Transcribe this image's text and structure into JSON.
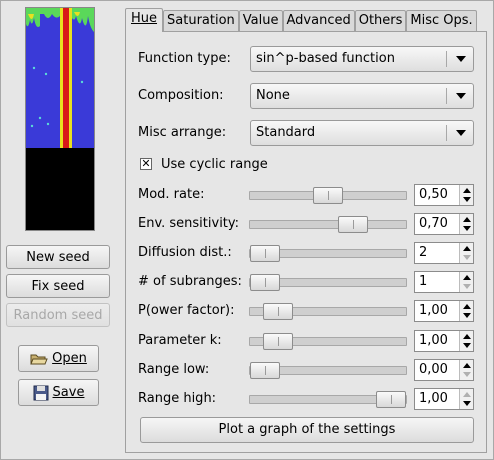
{
  "left": {
    "new_seed": "New seed",
    "fix_seed": "Fix seed",
    "random_seed": "Random seed",
    "open": "Open",
    "save": "Save"
  },
  "tabs": [
    {
      "label": "Hue",
      "active": true
    },
    {
      "label": "Saturation"
    },
    {
      "label": "Value"
    },
    {
      "label": "Advanced"
    },
    {
      "label": "Others"
    },
    {
      "label": "Misc Ops."
    }
  ],
  "hue": {
    "function_type_label": "Function type:",
    "function_type_value": "sin^p-based function",
    "composition_label": "Composition:",
    "composition_value": "None",
    "misc_arrange_label": "Misc arrange:",
    "misc_arrange_value": "Standard",
    "cyclic_label": "Use cyclic range",
    "cyclic_checked": true,
    "sliders": [
      {
        "label": "Mod. rate:",
        "value": "0,50",
        "fraction": 0.5
      },
      {
        "label": "Env. sensitivity:",
        "value": "0,70",
        "fraction": 0.7
      },
      {
        "label": "Diffusion dist.:",
        "value": "2",
        "fraction": 0.0
      },
      {
        "label": "# of subranges:",
        "value": "1",
        "fraction": 0.0
      },
      {
        "label": "P(ower factor):",
        "value": "1,00",
        "fraction": 0.1
      },
      {
        "label": "Parameter k:",
        "value": "1,00",
        "fraction": 0.1
      },
      {
        "label": "Range low:",
        "value": "0,00",
        "fraction": 0.0
      },
      {
        "label": "Range high:",
        "value": "1,00",
        "fraction": 1.0
      }
    ],
    "plot_button": "Plot a graph of the settings"
  },
  "colors": {
    "preview_blue": "#3a3ad8",
    "preview_red": "#d81818",
    "preview_green": "#5ad85a",
    "preview_yellow": "#e8e020"
  }
}
